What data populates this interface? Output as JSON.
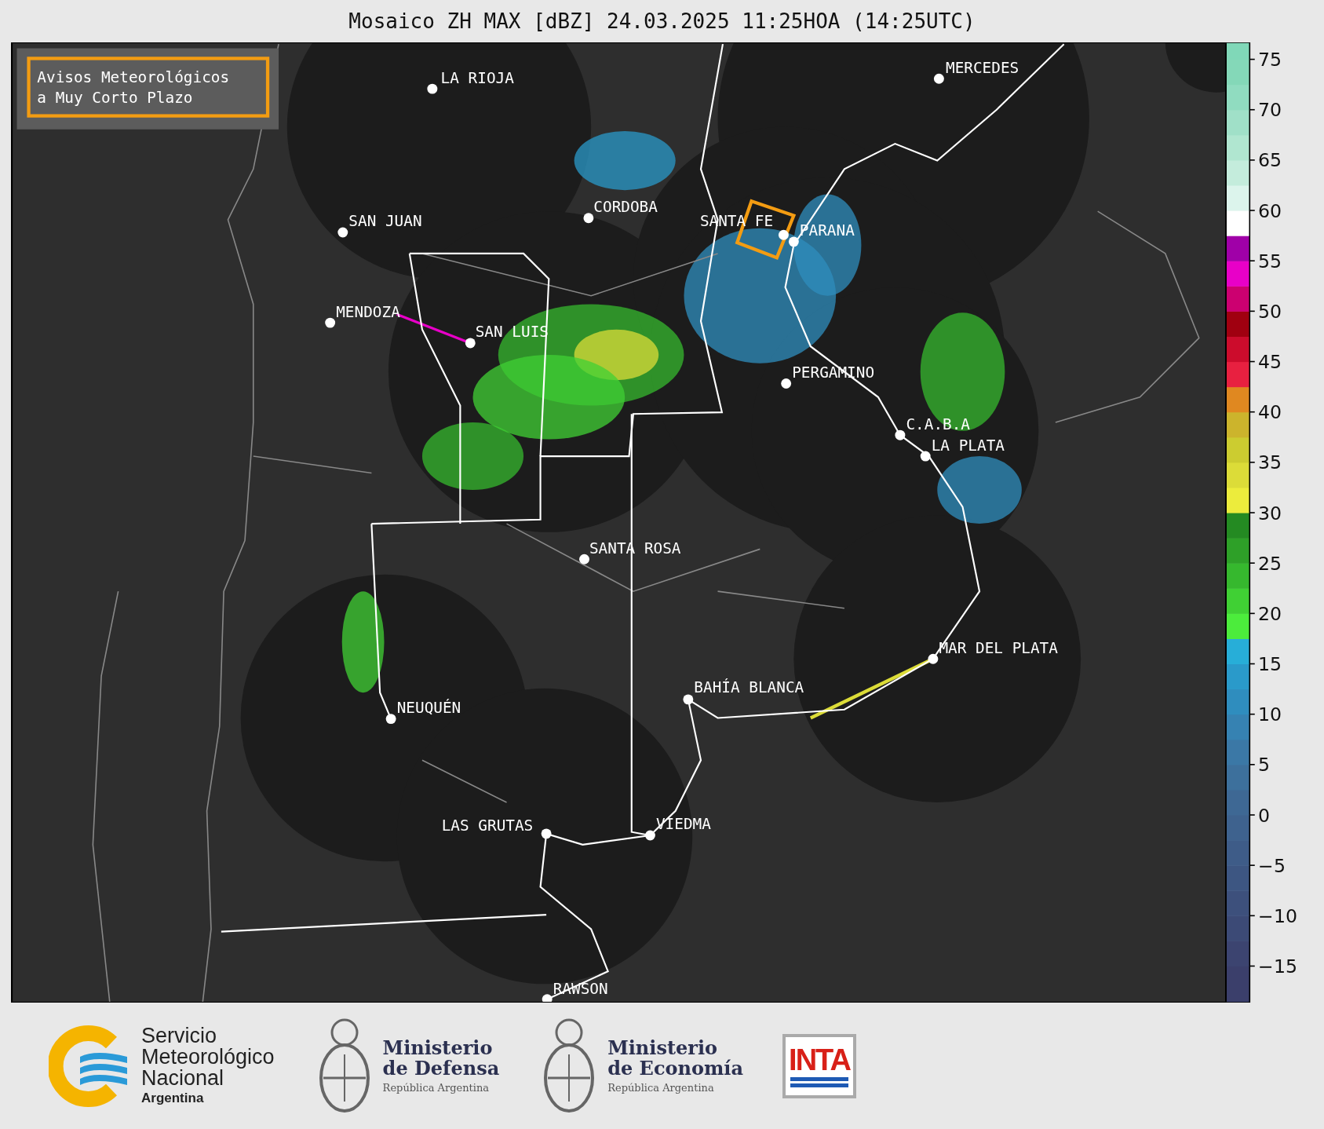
{
  "title": "Mosaico ZH MAX [dBZ] 24.03.2025 11:25HOA (14:25UTC)",
  "notice": {
    "lines": [
      "Avisos Meteorológicos",
      "a Muy Corto Plazo"
    ]
  },
  "cities": [
    {
      "name": "LA RIOJA"
    },
    {
      "name": "MERCEDES"
    },
    {
      "name": "SAN JUAN"
    },
    {
      "name": "CORDOBA"
    },
    {
      "name": "SANTA FE"
    },
    {
      "name": "PARANA"
    },
    {
      "name": "MENDOZA"
    },
    {
      "name": "SAN LUIS"
    },
    {
      "name": "PERGAMINO"
    },
    {
      "name": "C.A.B.A"
    },
    {
      "name": "LA PLATA"
    },
    {
      "name": "SANTA ROSA"
    },
    {
      "name": "MAR DEL PLATA"
    },
    {
      "name": "BAHÍA BLANCA"
    },
    {
      "name": "NEUQUÉN"
    },
    {
      "name": "LAS GRUTAS"
    },
    {
      "name": "VIEDMA"
    },
    {
      "name": "RAWSON"
    }
  ],
  "colorbar": {
    "ticks": [
      "75",
      "70",
      "65",
      "60",
      "55",
      "50",
      "45",
      "40",
      "35",
      "30",
      "25",
      "20",
      "15",
      "10",
      "5",
      "0",
      "−5",
      "−10",
      "−15"
    ]
  },
  "logos": [
    {
      "kind": "smn",
      "lines": [
        "Servicio",
        "Meteorológico",
        "Nacional"
      ],
      "subtitle": "Argentina"
    },
    {
      "kind": "ministry",
      "lines": [
        "Ministerio",
        "de Defensa"
      ],
      "subtitle": "República Argentina"
    },
    {
      "kind": "ministry",
      "lines": [
        "Ministerio",
        "de Economía"
      ],
      "subtitle": "República Argentina"
    },
    {
      "kind": "inta",
      "text": "INTA"
    }
  ]
}
